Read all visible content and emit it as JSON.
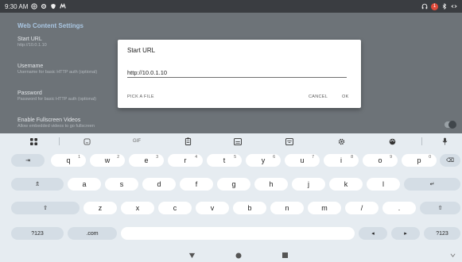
{
  "status_bar": {
    "time": "9:30 AM",
    "left_icons": [
      "wifi-calling-icon",
      "gear-icon",
      "shield-icon",
      "notification-icon"
    ],
    "badge_count": "1",
    "right_icons": [
      "headphones-icon",
      "bluetooth-icon",
      "link-icon"
    ]
  },
  "settings": {
    "title": "Web Content Settings",
    "items": [
      {
        "title": "Start URL",
        "subtitle": "http://10.0.1.10"
      },
      {
        "title": "Username",
        "subtitle": "Username for basic HTTP auth (optional)"
      },
      {
        "title": "Password",
        "subtitle": "Password for basic HTTP auth (optional)"
      },
      {
        "title": "Enable Fullscreen Videos",
        "subtitle": "Allow embedded videos to go fullscreen"
      }
    ]
  },
  "dialog": {
    "title": "Start URL",
    "input_value": "http://10.0.1.10",
    "pick_file": "PICK A FILE",
    "cancel": "CANCEL",
    "ok": "OK"
  },
  "keyboard": {
    "toolbar": {
      "gif": "GIF"
    },
    "row1": [
      {
        "label": "q",
        "num": "1"
      },
      {
        "label": "w",
        "num": "2"
      },
      {
        "label": "e",
        "num": "3"
      },
      {
        "label": "r",
        "num": "4"
      },
      {
        "label": "t",
        "num": "5"
      },
      {
        "label": "y",
        "num": "6"
      },
      {
        "label": "u",
        "num": "7"
      },
      {
        "label": "i",
        "num": "8"
      },
      {
        "label": "o",
        "num": "9"
      },
      {
        "label": "p",
        "num": "0"
      }
    ],
    "row2": [
      "a",
      "s",
      "d",
      "f",
      "g",
      "h",
      "j",
      "k",
      "l"
    ],
    "row3": [
      "z",
      "x",
      "c",
      "v",
      "b",
      "n",
      "m",
      "/",
      "."
    ],
    "tab": "⇥",
    "backspace": "⌫",
    "caps": "⇬",
    "enter": "↵",
    "shift": "⇧",
    "symbols": "?123",
    "dotcom": ".com",
    "left": "◂",
    "right": "▸"
  },
  "colors": {
    "accent": "#a9c6e2",
    "dialog_bg": "#ffffff",
    "keyboard_bg": "#e6ecf1",
    "status_badge": "#e04a3a"
  }
}
